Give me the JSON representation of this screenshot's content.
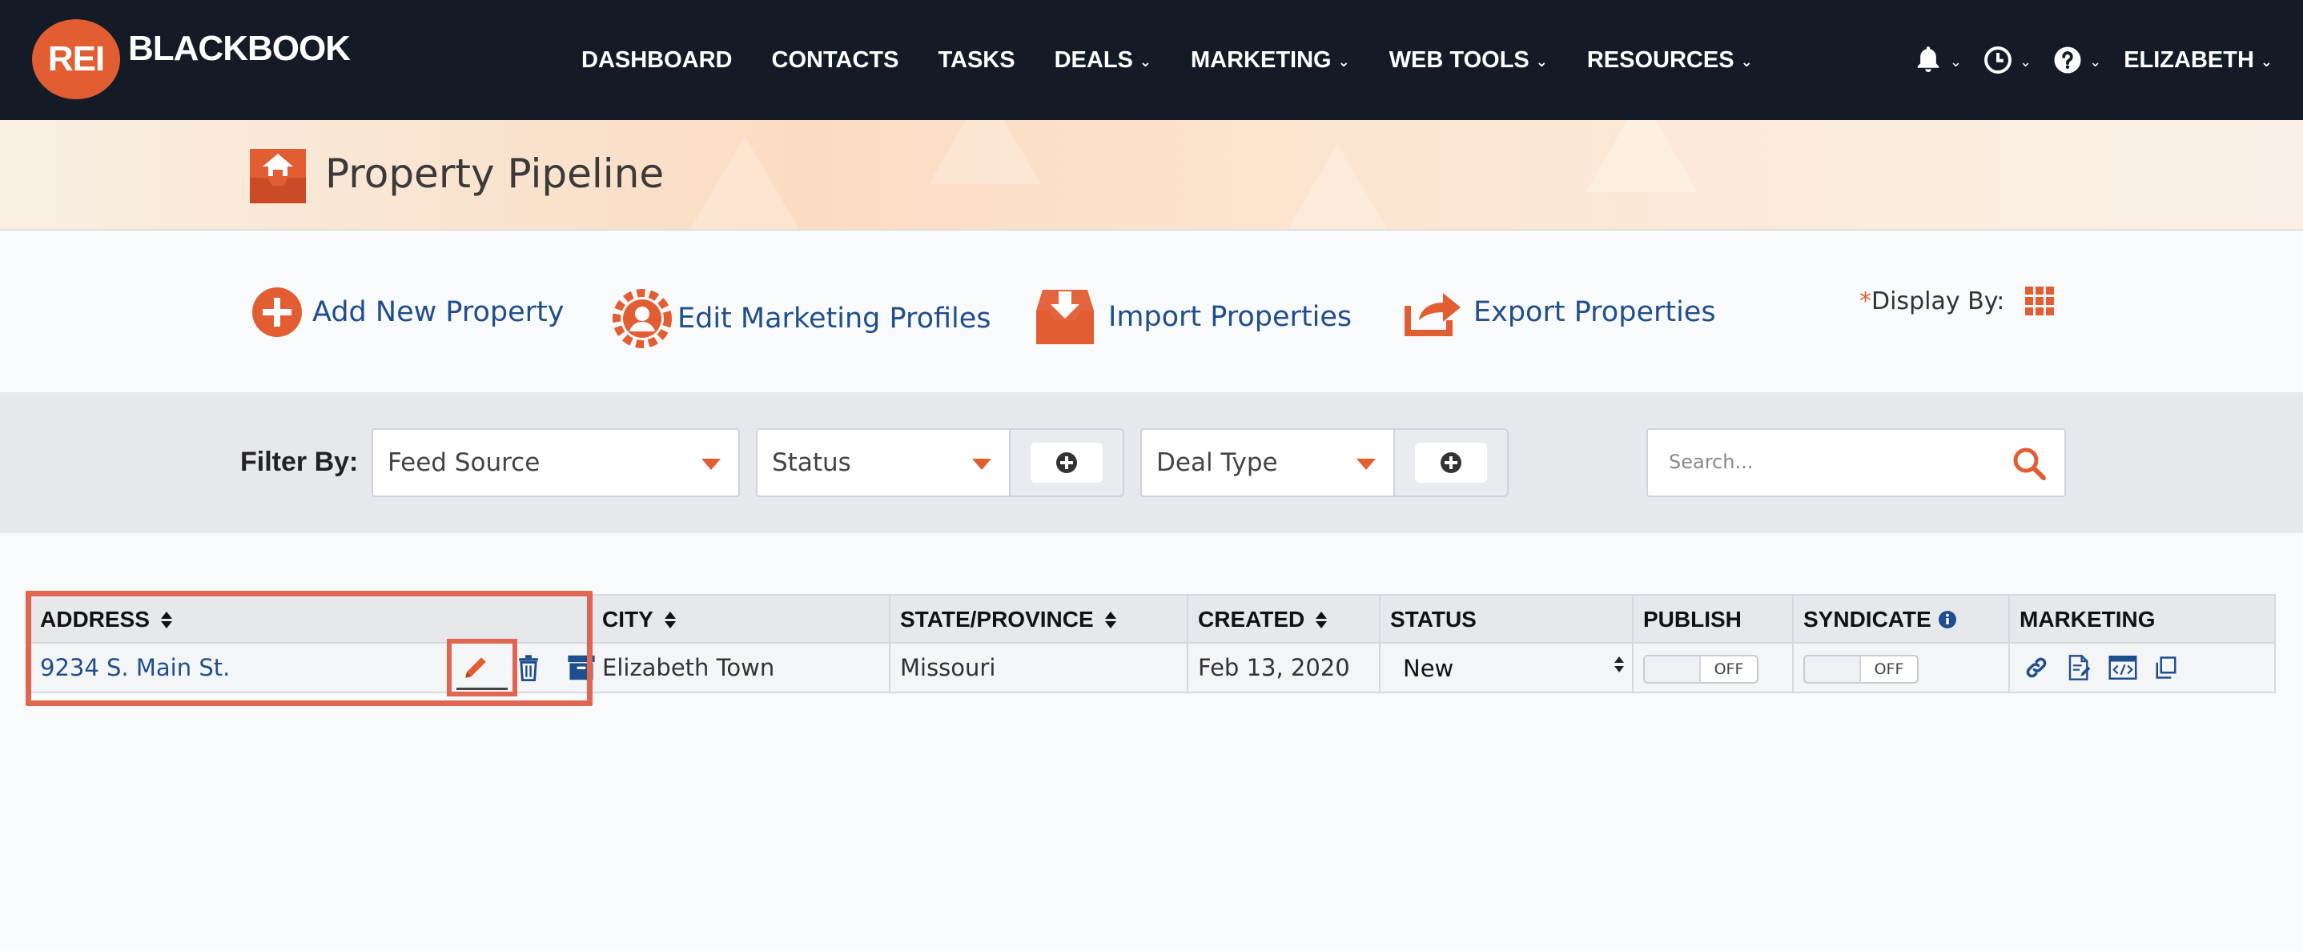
{
  "brand": {
    "logo_badge": "REI",
    "logo_word": "BLACKBOOK",
    "accent": "#e35d33",
    "nav_bg": "#141b27",
    "link": "#1f4e8c"
  },
  "nav": {
    "items": [
      {
        "label": "DASHBOARD",
        "dropdown": false
      },
      {
        "label": "CONTACTS",
        "dropdown": false
      },
      {
        "label": "TASKS",
        "dropdown": false
      },
      {
        "label": "DEALS",
        "dropdown": true
      },
      {
        "label": "MARKETING",
        "dropdown": true
      },
      {
        "label": "WEB TOOLS",
        "dropdown": true
      },
      {
        "label": "RESOURCES",
        "dropdown": true
      }
    ],
    "icons": [
      "bell-icon",
      "clock-icon",
      "help-icon"
    ],
    "user": "ELIZABETH"
  },
  "page": {
    "title": "Property Pipeline"
  },
  "actions": {
    "add_new": "Add New Property",
    "edit_profiles": "Edit Marketing Profiles",
    "import": "Import Properties",
    "export": "Export Properties",
    "display_required": "*",
    "display_by": "Display By:"
  },
  "filters": {
    "label": "Filter By:",
    "feed_source": "Feed Source",
    "status": "Status",
    "deal_type": "Deal Type",
    "search_placeholder": "Search..."
  },
  "table": {
    "headers": {
      "address": "ADDRESS",
      "city": "CITY",
      "state": "STATE/PROVINCE",
      "created": "CREATED",
      "status": "STATUS",
      "publish": "PUBLISH",
      "syndicate": "SYNDICATE",
      "marketing": "MARKETING"
    },
    "rows": [
      {
        "address": "9234 S. Main St.",
        "city": "Elizabeth Town",
        "state": "Missouri",
        "created": "Feb 13, 2020",
        "status": "New",
        "publish": "OFF",
        "syndicate": "OFF"
      }
    ]
  }
}
